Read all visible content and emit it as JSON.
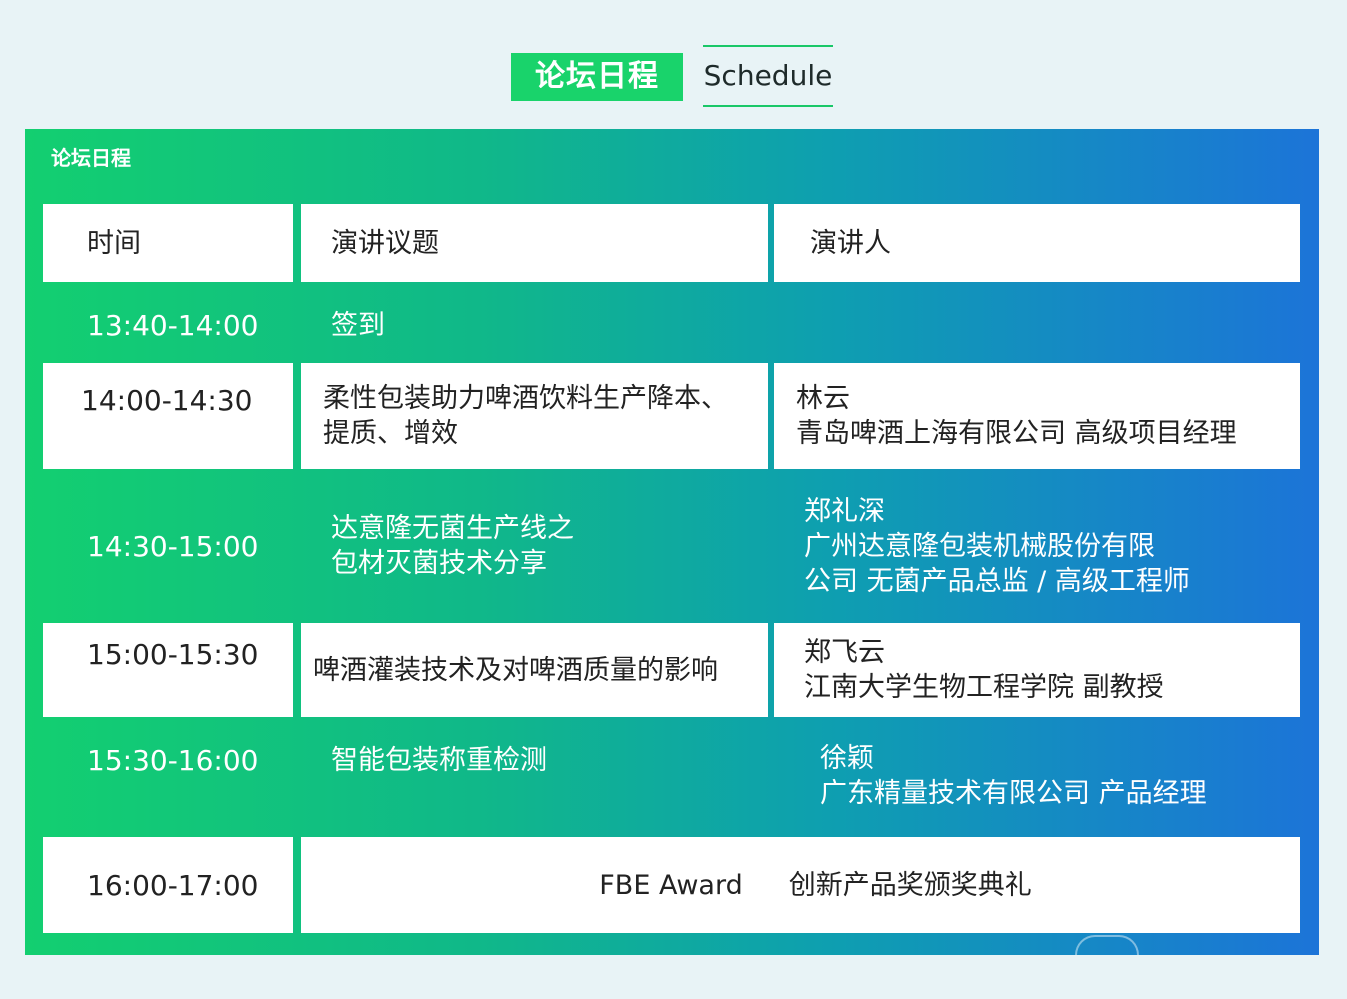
{
  "header": {
    "title_cn": "论坛日程",
    "title_en": "Schedule"
  },
  "panel": {
    "title": "论坛日程"
  },
  "table": {
    "columns": [
      "时间",
      "演讲议题",
      "演讲人"
    ],
    "rows": [
      {
        "time": "13:40-14:00",
        "topic": [
          "签到"
        ],
        "speaker": []
      },
      {
        "time": "14:00-14:30",
        "topic": [
          "柔性包装助力啤酒饮料生产降本、",
          "提质、增效"
        ],
        "speaker": [
          "林云",
          "青岛啤酒上海有限公司 高级项目经理"
        ]
      },
      {
        "time": "14:30-15:00",
        "topic": [
          "达意隆无菌生产线之",
          "包材灭菌技术分享"
        ],
        "speaker": [
          "郑礼深",
          "广州达意隆包装机械股份有限",
          "公司 无菌产品总监 / 高级工程师"
        ]
      },
      {
        "time": "15:00-15:30",
        "topic": [
          "啤酒灌装技术及对啤酒质量的影响"
        ],
        "speaker": [
          "郑飞云",
          "江南大学生物工程学院 副教授"
        ]
      },
      {
        "time": "15:30-16:00",
        "topic": [
          "智能包装称重检测"
        ],
        "speaker": [
          "徐颖",
          "广东精量技术有限公司 产品经理"
        ]
      },
      {
        "time": "16:00-17:00",
        "topic": [
          "FBE Award",
          "创新产品奖颁奖典礼"
        ],
        "speaker": []
      }
    ]
  }
}
